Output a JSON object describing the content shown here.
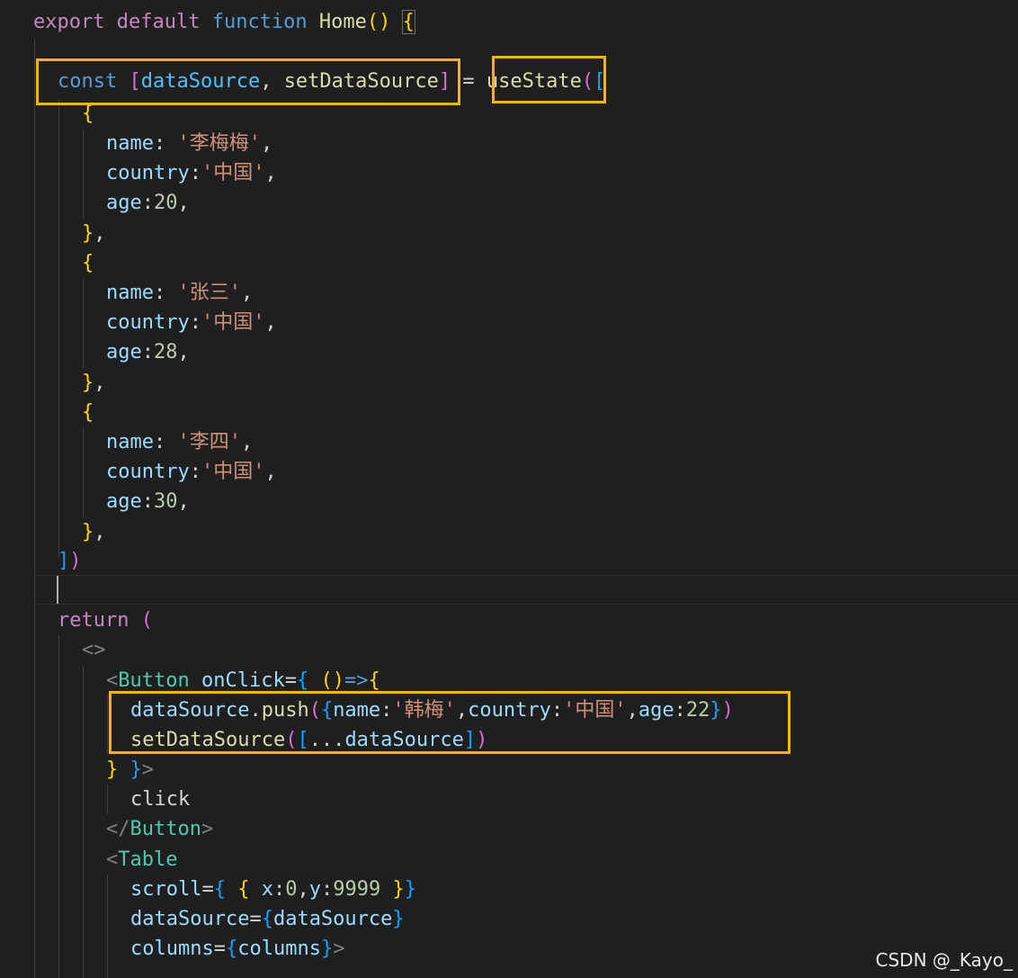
{
  "editor": {
    "watermark": "CSDN @_Kayo_",
    "colors": {
      "background": "#1f1f1f",
      "highlight_box": "#f2b600",
      "keyword": "#c586c0",
      "storage": "#569cd6",
      "function": "#dcdcaa",
      "variable": "#9cdcfe",
      "string": "#ce9178",
      "number": "#b5cea8",
      "component": "#4ec9b0"
    },
    "lines": {
      "l01": {
        "t1": "export",
        "t2": "default",
        "t3": "function",
        "t4": "Home",
        "t5": "()",
        "t6": "{"
      },
      "l02": {
        "t1": "const",
        "t2": "[",
        "t3": "dataSource",
        "t4": ",",
        "t5": "setDataSource",
        "t6": "]",
        "t7": "=",
        "t8": "useState",
        "t9": "(",
        "t10": "["
      },
      "l03": {
        "t1": "{"
      },
      "l04": {
        "t1": "name",
        "t2": ":",
        "t3": "'李梅梅'",
        "t4": ","
      },
      "l05": {
        "t1": "country",
        "t2": ":",
        "t3": "'中国'",
        "t4": ","
      },
      "l06": {
        "t1": "age",
        "t2": ":",
        "t3": "20",
        "t4": ","
      },
      "l07": {
        "t1": "}",
        "t2": ","
      },
      "l08": {
        "t1": "{"
      },
      "l09": {
        "t1": "name",
        "t2": ":",
        "t3": "'张三'",
        "t4": ","
      },
      "l10": {
        "t1": "country",
        "t2": ":",
        "t3": "'中国'",
        "t4": ","
      },
      "l11": {
        "t1": "age",
        "t2": ":",
        "t3": "28",
        "t4": ","
      },
      "l12": {
        "t1": "}",
        "t2": ","
      },
      "l13": {
        "t1": "{"
      },
      "l14": {
        "t1": "name",
        "t2": ":",
        "t3": "'李四'",
        "t4": ","
      },
      "l15": {
        "t1": "country",
        "t2": ":",
        "t3": "'中国'",
        "t4": ","
      },
      "l16": {
        "t1": "age",
        "t2": ":",
        "t3": "30",
        "t4": ","
      },
      "l17": {
        "t1": "}",
        "t2": ","
      },
      "l18": {
        "t1": "]",
        "t2": ")"
      },
      "l20": {
        "t1": "return",
        "t2": "("
      },
      "l21": {
        "t1": "<>"
      },
      "l22": {
        "t1": "<",
        "t2": "Button",
        "t3": "onClick",
        "t4": "=",
        "t5": "{",
        "t6": "()",
        "t7": "=>",
        "t8": "{"
      },
      "l23": {
        "t1": "dataSource",
        "t2": ".",
        "t3": "push",
        "t4": "(",
        "t5": "{",
        "t6": "name",
        "t7": ":",
        "t8": "'韩梅'",
        "t9": ",",
        "t10": "country",
        "t11": ":",
        "t12": "'中国'",
        "t13": ",",
        "t14": "age",
        "t15": ":",
        "t16": "22",
        "t17": "}",
        "t18": ")"
      },
      "l24": {
        "t1": "setDataSource",
        "t2": "(",
        "t3": "[",
        "t4": "...",
        "t5": "dataSource",
        "t6": "]",
        "t7": ")"
      },
      "l25": {
        "t1": "}",
        "t2": "}",
        "t3": ">"
      },
      "l26": {
        "t1": "click"
      },
      "l27": {
        "t1": "</",
        "t2": "Button",
        "t3": ">"
      },
      "l28": {
        "t1": "<",
        "t2": "Table"
      },
      "l29": {
        "t1": "scroll",
        "t2": "=",
        "t3": "{",
        "t4": "{",
        "t5": "x",
        "t6": ":",
        "t7": "0",
        "t8": ",",
        "t9": "y",
        "t10": ":",
        "t11": "9999",
        "t12": "}",
        "t13": "}"
      },
      "l30": {
        "t1": "dataSource",
        "t2": "=",
        "t3": "{",
        "t4": "dataSource",
        "t5": "}"
      },
      "l31": {
        "t1": "columns",
        "t2": "=",
        "t3": "{",
        "t4": "columns",
        "t5": "}",
        "t6": ">"
      }
    }
  }
}
